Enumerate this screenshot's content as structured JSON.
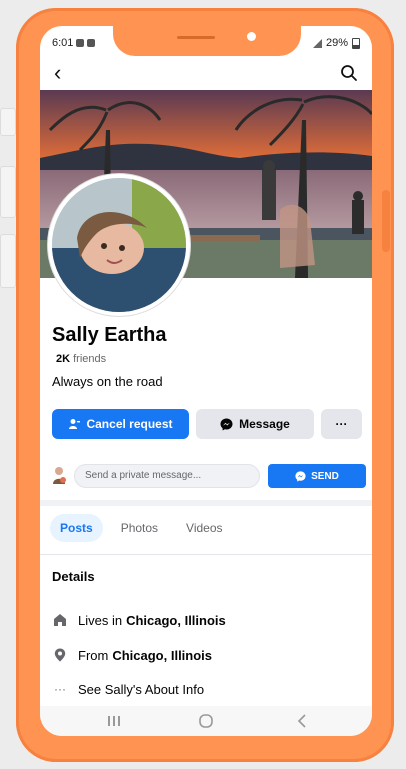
{
  "status": {
    "time": "6:01",
    "battery": "29%"
  },
  "profile": {
    "name": "Sally Eartha",
    "friends_count": "2K",
    "friends_label": "friends",
    "bio": "Always on the road"
  },
  "actions": {
    "cancel_request": "Cancel request",
    "message": "Message",
    "more": "···"
  },
  "private_message": {
    "placeholder": "Send a private message...",
    "send": "SEND"
  },
  "tabs": [
    {
      "label": "Posts",
      "active": true
    },
    {
      "label": "Photos",
      "active": false
    },
    {
      "label": "Videos",
      "active": false
    }
  ],
  "details": {
    "title": "Details",
    "lives_prefix": "Lives in",
    "lives_city": "Chicago, Illinois",
    "from_prefix": "From",
    "from_city": "Chicago, Illinois",
    "about": "See Sally's About Info"
  },
  "colors": {
    "accent": "#1877f2",
    "phone_frame": "#ff9452"
  },
  "icons": {
    "back": "back-arrow-icon",
    "search": "search-icon",
    "home": "home-icon",
    "location": "location-pin-icon",
    "more": "ellipsis-icon"
  }
}
